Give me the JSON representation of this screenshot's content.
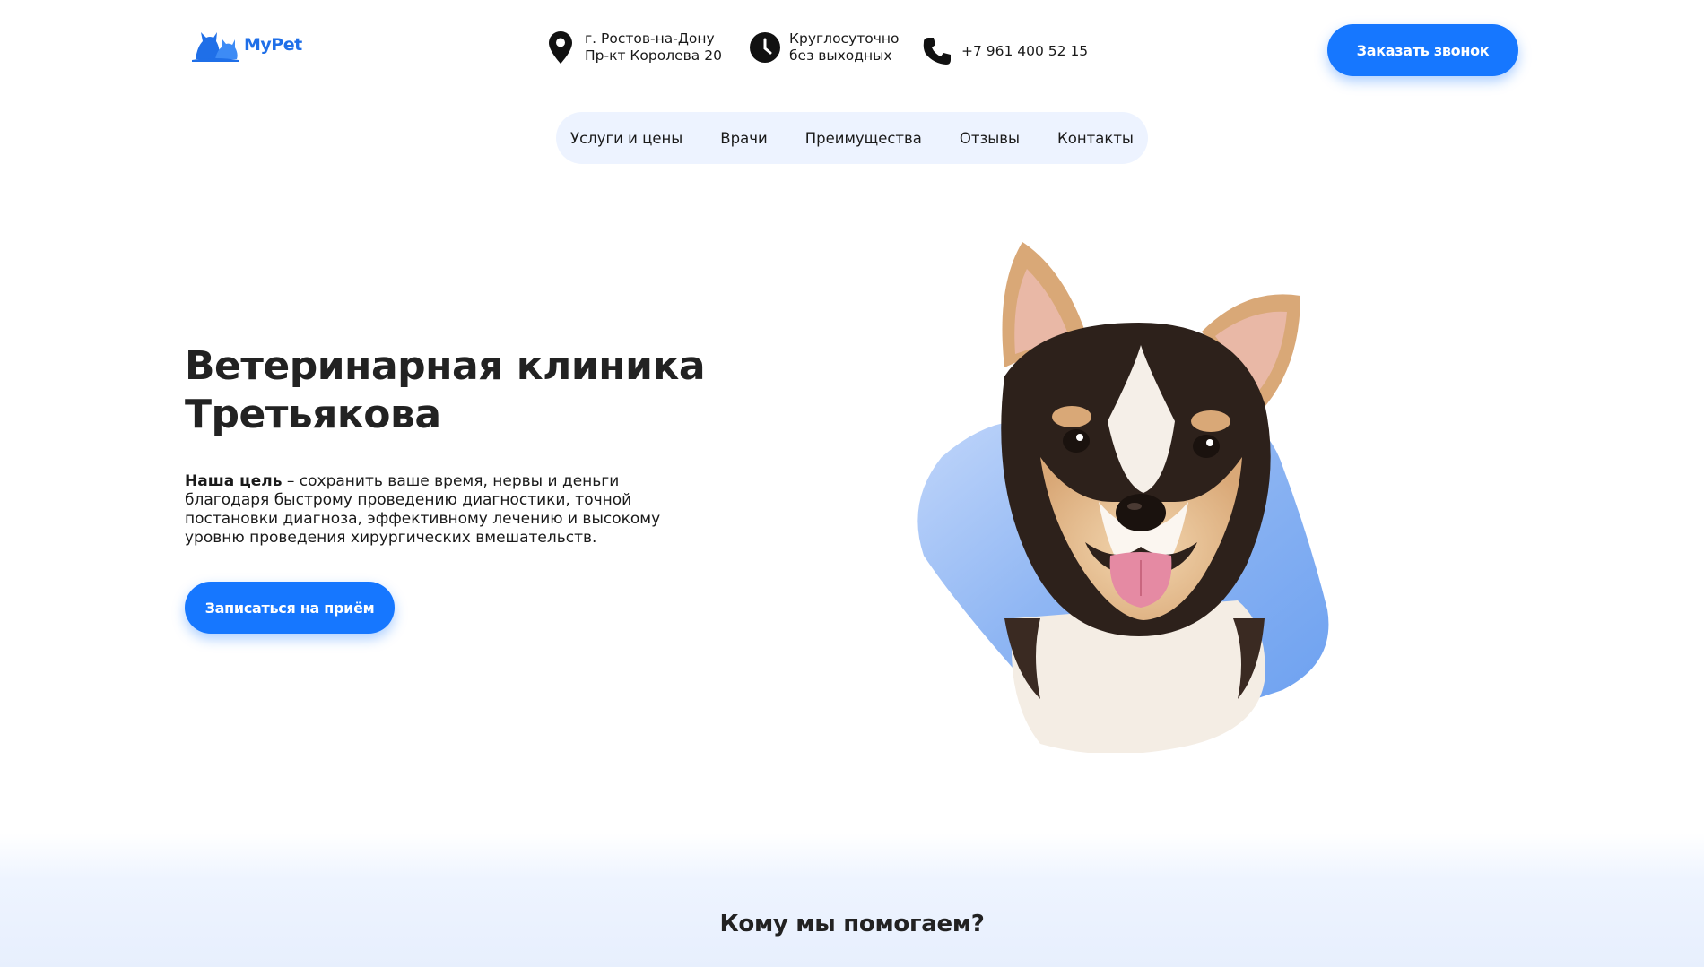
{
  "brand": {
    "name": "MyPet",
    "color": "#1677ff"
  },
  "header": {
    "address_line1": "г. Ростов-на-Дону",
    "address_line2": "Пр-кт Королева 20",
    "hours_line1": "Круглосуточно",
    "hours_line2": "без выходных",
    "phone": "+7 961 400 52 15",
    "callback_label": "Заказать звонок"
  },
  "nav": {
    "items": [
      "Услуги и цены",
      "Врачи",
      "Преимущества",
      "Отзывы",
      "Контакты"
    ]
  },
  "hero": {
    "title_line1": "Ветеринарная клиника",
    "title_line2": "Третьякова",
    "desc_bold": "Наша цель",
    "desc_rest": " – сохранить ваше время, нервы и деньги благодаря быстрому проведению диагностики, точной постановки диагноза, эффективному лечению и высокому уровню проведения хирургических вмешательств.",
    "cta_label": "Записаться на приём"
  },
  "section": {
    "title": "Кому мы помогаем?"
  },
  "icons": {
    "logo": "cat-dog-logo-icon",
    "address": "location-pin-icon",
    "hours": "clock-icon",
    "phone": "phone-icon"
  }
}
